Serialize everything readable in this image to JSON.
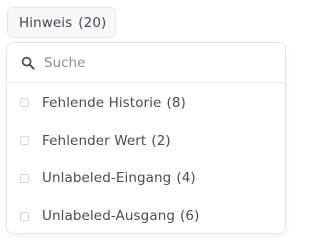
{
  "filter_button": {
    "label": "Hinweis",
    "count": "(20)"
  },
  "dropdown": {
    "search": {
      "placeholder": "Suche",
      "value": ""
    },
    "options": [
      {
        "label": "Fehlende Historie",
        "count": "(8)",
        "checked": false
      },
      {
        "label": "Fehlender Wert",
        "count": "(2)",
        "checked": false
      },
      {
        "label": "Unlabeled-Eingang",
        "count": "(4)",
        "checked": false
      },
      {
        "label": "Unlabeled-Ausgang",
        "count": "(6)",
        "checked": false
      }
    ]
  },
  "colors": {
    "border": "#e6e8ec",
    "trigger_background": "#f7f8fa",
    "text": "#464d58",
    "placeholder": "#8a919c",
    "checkbox_border": "#d3d7dd"
  },
  "icons": {
    "search": "search-icon"
  }
}
